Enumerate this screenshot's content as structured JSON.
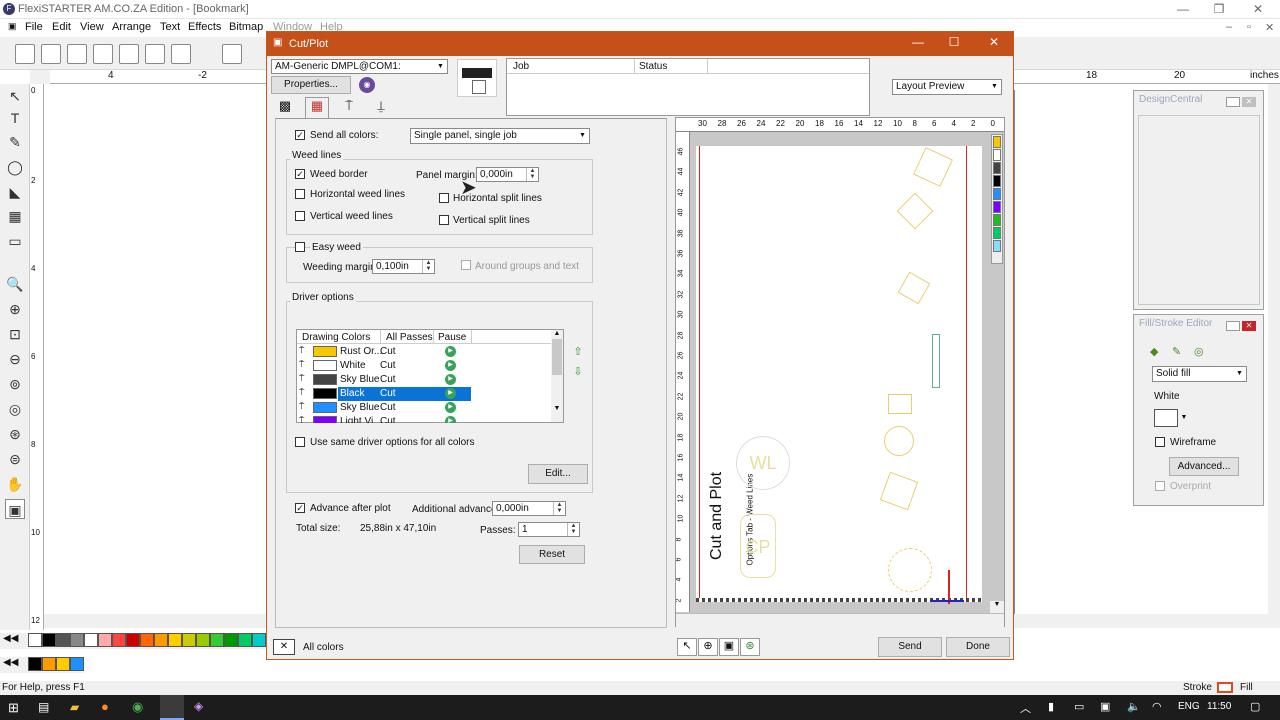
{
  "app": {
    "title": "FlexiSTARTER AM.CO.ZA Edition - [Bookmark]",
    "icon": "app-icon",
    "status": "For Help, press F1",
    "stroke_label": "Stroke",
    "fill_label": "Fill",
    "stroke_color": "#e34a1b"
  },
  "menu": [
    "File",
    "Edit",
    "View",
    "Arrange",
    "Text",
    "Effects",
    "Bitmap",
    "Window",
    "Help"
  ],
  "ruler_top": [
    "4",
    "-2",
    "18",
    "20",
    "inches"
  ],
  "ruler_left": [
    "0",
    "2",
    "4",
    "6",
    "8",
    "10",
    "12"
  ],
  "dialog": {
    "title": "Cut/Plot",
    "device": "AM-Generic DMPL@COM1:",
    "properties": "Properties...",
    "job_header": "Job",
    "status_header": "Status",
    "view_select": "Layout Preview",
    "send_all_colors": "Send all colors:",
    "job_mode": "Single panel, single job",
    "weed_lines": "Weed lines",
    "weed_border": "Weed border",
    "panel_margin_label": "Panel margin:",
    "panel_margin": "0,000in",
    "horizontal_weed": "Horizontal weed lines",
    "horizontal_split": "Horizontal split lines",
    "vertical_weed": "Vertical weed lines",
    "vertical_split": "Vertical split lines",
    "easy_weed": "Easy weed",
    "weeding_margin_label": "Weeding margin:",
    "weeding_margin": "0,100in",
    "around_groups": "Around groups and text",
    "driver_options": "Driver options",
    "table_headers": [
      "Drawing Colors",
      "All Passes",
      "Pause"
    ],
    "rows": [
      {
        "name": "Rust Or...",
        "color": "#f5c800",
        "mode": "Cut",
        "selected": false
      },
      {
        "name": "White",
        "color": "#ffffff",
        "mode": "Cut",
        "selected": false
      },
      {
        "name": "Sky Blue",
        "color": "#444444",
        "mode": "Cut",
        "selected": false
      },
      {
        "name": "Black",
        "color": "#000000",
        "mode": "Cut",
        "selected": true
      },
      {
        "name": "Sky Blue",
        "color": "#1e90ff",
        "mode": "Cut",
        "selected": false
      },
      {
        "name": "Light Vi...",
        "color": "#7b00ff",
        "mode": "Cut",
        "selected": false
      }
    ],
    "same_driver": "Use same driver options for all colors",
    "edit": "Edit...",
    "advance_after_plot": "Advance after plot",
    "additional_advance_label": "Additional advance:",
    "additional_advance": "0,000in",
    "total_size_label": "Total size:",
    "total_size": "25,88in x 47,10in",
    "passes_label": "Passes:",
    "passes": "1",
    "reset": "Reset",
    "all_colors": "All colors",
    "send": "Send",
    "done": "Done",
    "preview_ruler_top": [
      "30",
      "28",
      "26",
      "24",
      "22",
      "20",
      "18",
      "16",
      "14",
      "12",
      "10",
      "8",
      "6",
      "4",
      "2",
      "0"
    ],
    "preview_ruler_left": [
      "46",
      "44",
      "42",
      "40",
      "38",
      "36",
      "34",
      "32",
      "30",
      "28",
      "26",
      "24",
      "22",
      "20",
      "18",
      "16",
      "14",
      "12",
      "10",
      "8",
      "6",
      "4",
      "2"
    ],
    "preview_text1": "Cut and Plot",
    "preview_text2": "Options Tab - Weed Lines",
    "preview_wl": "WL",
    "preview_cp": "CP",
    "preview_palette": [
      "#f5c800",
      "#ffffff",
      "#444444",
      "#000000",
      "#1e90ff",
      "#7b00ff",
      "#22bb22",
      "#00cc66",
      "#88ddff"
    ]
  },
  "design_central": {
    "title": "DesignCentral"
  },
  "fill_stroke": {
    "title": "Fill/Stroke Editor",
    "fill_type": "Solid fill",
    "color_name": "White",
    "wireframe": "Wireframe",
    "advanced": "Advanced...",
    "overprint": "Overprint"
  },
  "palette1": [
    "#ffffff",
    "#000000",
    "#555555",
    "#888888",
    "#ffffff",
    "#ffaaaa",
    "#ff4444",
    "#cc0000",
    "#ff6600",
    "#ff9900",
    "#ffcc00",
    "#cccc00",
    "#99cc00",
    "#33cc33",
    "#009900",
    "#00cc66",
    "#00cccc",
    "#33ccff"
  ],
  "palette2": [
    "#000000",
    "#ff9900",
    "#ffcc00",
    "#1e90ff"
  ],
  "taskbar": {
    "lang": "ENG",
    "time": "11:50"
  }
}
